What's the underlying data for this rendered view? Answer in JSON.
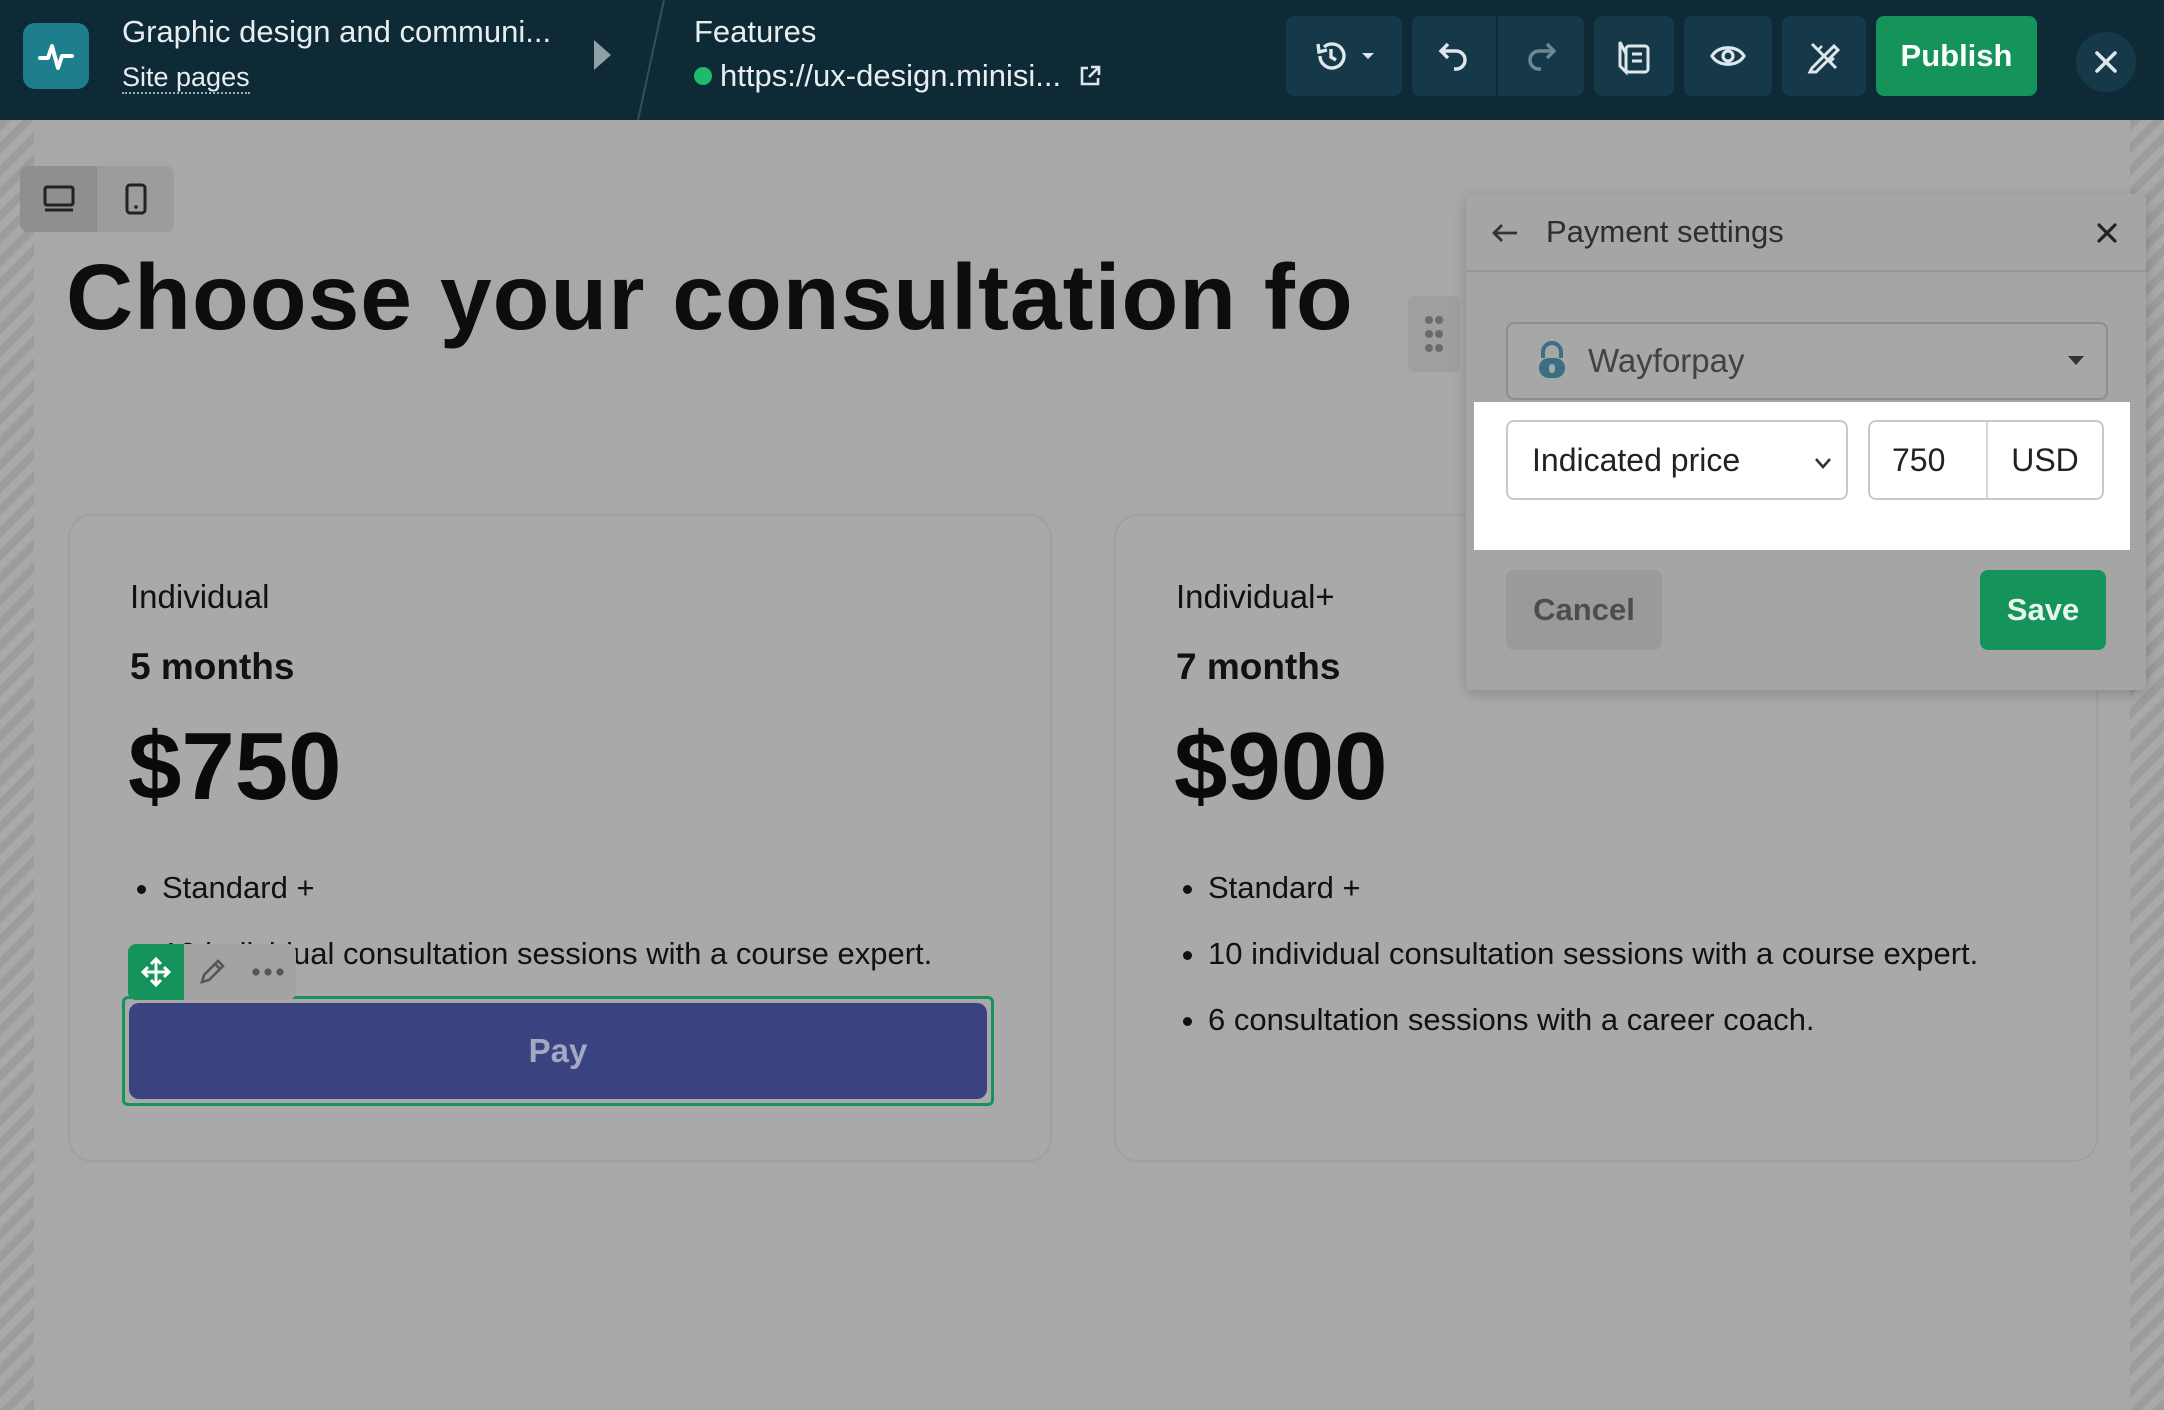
{
  "topbar": {
    "site_title": "Graphic design and communi...",
    "site_pages": "Site pages",
    "page_name": "Features",
    "page_url": "https://ux-design.minisi...",
    "publish_label": "Publish"
  },
  "canvas": {
    "headline": "Choose your consultation fo",
    "cards": [
      {
        "tier": "Individual",
        "duration": "5 months",
        "price": "$750",
        "features": [
          "Standard +",
          "10 individual consultation sessions with a course expert."
        ]
      },
      {
        "tier": "Individual+",
        "duration": "7 months",
        "price": "$900",
        "features": [
          "Standard +",
          "10 individual consultation sessions with a course expert.",
          "6 consultation sessions with a career coach."
        ]
      }
    ],
    "pay_label": "Pay"
  },
  "panel": {
    "title": "Payment settings",
    "provider": "Wayforpay",
    "price_type": "Indicated price",
    "amount": "750",
    "currency": "USD",
    "cancel_label": "Cancel",
    "save_label": "Save"
  },
  "colors": {
    "topbar_bg": "#0d2a36",
    "accent_green": "#14935a",
    "pay_button": "#3a4280",
    "status_online": "#1fba6c"
  }
}
